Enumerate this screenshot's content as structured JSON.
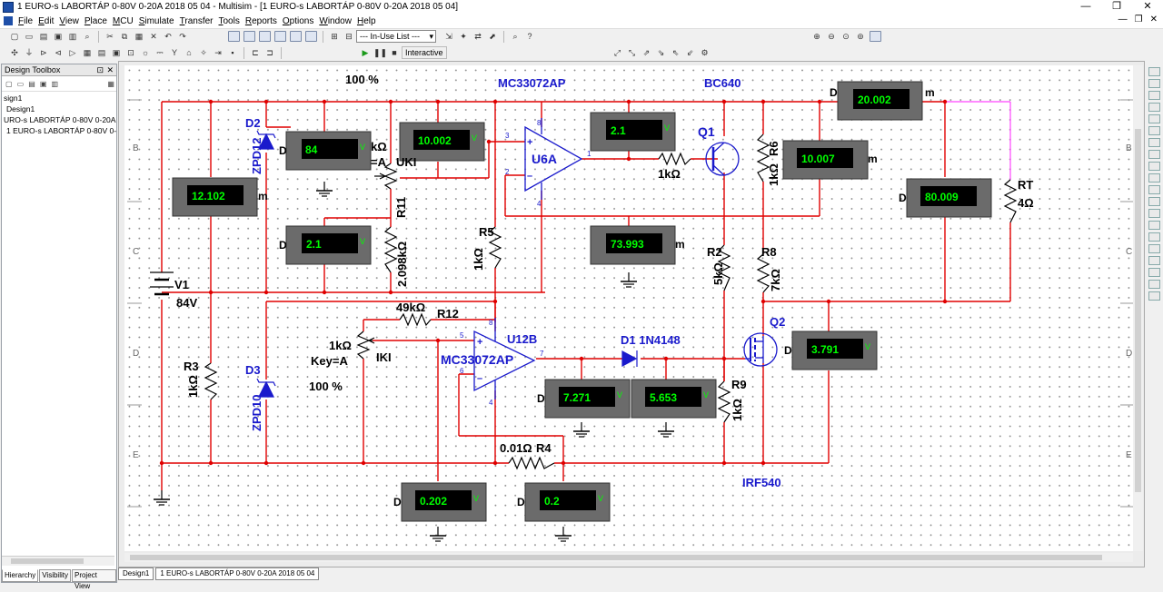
{
  "window": {
    "title": "1 EURO-s LABORTÁP 0-80V 0-20A  2018 05 04 - Multisim - [1 EURO-s LABORTÁP 0-80V 0-20A  2018 05 04]",
    "minimize": "—",
    "restore": "❐",
    "close": "✕"
  },
  "menu": [
    "File",
    "Edit",
    "View",
    "Place",
    "MCU",
    "Simulate",
    "Transfer",
    "Tools",
    "Reports",
    "Options",
    "Window",
    "Help"
  ],
  "toolbar": {
    "in_use_list": "--- In-Use List ---",
    "interactive": "Interactive"
  },
  "design_toolbox": {
    "title": "Design Toolbox",
    "tree": [
      "sign1",
      "Design1",
      "URO-s LABORTÁP 0-80V 0-20A  20",
      "1 EURO-s LABORTÁP 0-80V 0-20A"
    ],
    "tabs": [
      "Hierarchy",
      "Visibility",
      "Project View"
    ]
  },
  "doc_tabs": [
    "Design1",
    "1 EURO-s LABORTÁP 0-80V 0-20A  2018 05 04"
  ],
  "border": {
    "rows": [
      "B",
      "C",
      "D",
      "E"
    ]
  },
  "schematic": {
    "labels": {
      "pct_top": "100 %",
      "mc33072_top": "MC33072AP",
      "bc640": "BC640",
      "d2": "D2",
      "zpd12": "ZPD12",
      "kohm_frag": "kΩ",
      "eq_a_frag": "=A",
      "uki_frag": "UKI",
      "r11": "R11",
      "r11_val": "2.098kΩ",
      "u6a": "U6A",
      "q1": "Q1",
      "r_1k_q1": "1kΩ",
      "r6_val": "1kΩ",
      "r6": "R6",
      "rt": "RT",
      "rt_val": "4Ω",
      "r5": "R5",
      "r5_val": "1kΩ",
      "r2": "R2",
      "r2_val": "5kΩ",
      "r8": "R8",
      "r8_val": "7kΩ",
      "v1": "V1",
      "v1_val": "84V",
      "r12_val": "49kΩ",
      "r12": "R12",
      "u12b": "U12B",
      "mc33072_bot": "MC33072AP",
      "d1": "D1 1N4148",
      "q2": "Q2",
      "pot2_val": "1kΩ",
      "key": "Key=A",
      "iki": "IKI",
      "pct_bot": "100 %",
      "r3": "R3",
      "r3_val": "1kΩ",
      "d3": "D3",
      "zpd10": "ZPD10",
      "r9": "R9",
      "r9_val": "1kΩ",
      "r4_val": "0.01Ω",
      "r4": "R4",
      "irf540": "IRF540",
      "m_suffix": "m",
      "d_prefix": "D",
      "v_suffix": "V"
    },
    "pins": {
      "u6_8": "8",
      "u6_3": "3",
      "u6_2": "2",
      "u6_4": "4",
      "u6_1": "1",
      "u12_8": "8",
      "u12_5": "5",
      "u12_6": "6",
      "u12_4": "4",
      "u12_7": "7"
    },
    "meters": [
      {
        "id": "m1",
        "value": "84"
      },
      {
        "id": "m2",
        "value": "10.002"
      },
      {
        "id": "m3",
        "value": "2.1"
      },
      {
        "id": "m4",
        "value": "20.002"
      },
      {
        "id": "m5",
        "value": "12.102"
      },
      {
        "id": "m6",
        "value": "10.007"
      },
      {
        "id": "m7",
        "value": "80.009"
      },
      {
        "id": "m8",
        "value": "2.1"
      },
      {
        "id": "m9",
        "value": "73.993"
      },
      {
        "id": "m10",
        "value": "3.791"
      },
      {
        "id": "m11",
        "value": "7.271"
      },
      {
        "id": "m12",
        "value": "5.653"
      },
      {
        "id": "m13",
        "value": "0.202"
      },
      {
        "id": "m14",
        "value": "0.2"
      }
    ],
    "colors": {
      "wire": "#e00000",
      "pink": "#ff44ff",
      "component": "#000000",
      "label": "#1a1acc",
      "meter_face": "#6b6b6b",
      "lcd": "#000000",
      "lcd_text": "#00ff00"
    }
  }
}
